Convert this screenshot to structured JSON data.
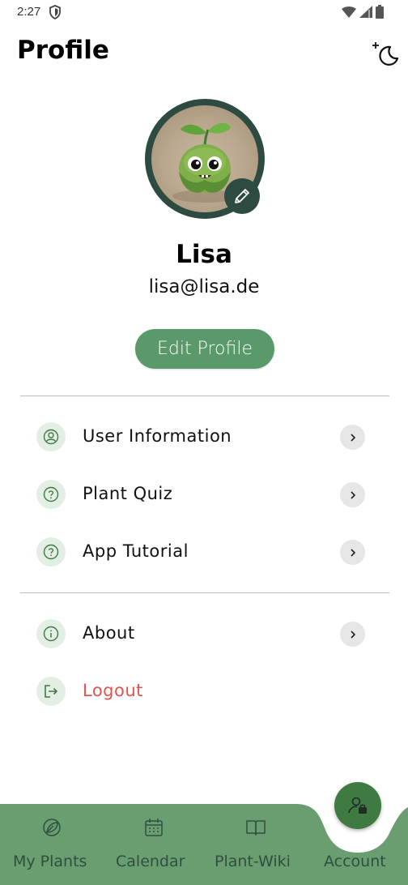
{
  "status_bar": {
    "time": "2:27"
  },
  "header": {
    "title": "Profile",
    "theme_toggle_icon": "moon-sparkle-icon"
  },
  "profile": {
    "name": "Lisa",
    "email": "lisa@lisa.de",
    "edit_button": "Edit Profile",
    "avatar_icon": "plant-character-avatar",
    "edit_avatar_icon": "pencil-icon"
  },
  "menu": {
    "section1": [
      {
        "label": "User Information",
        "icon": "user-circle-icon"
      },
      {
        "label": "Plant Quiz",
        "icon": "question-circle-icon"
      },
      {
        "label": "App Tutorial",
        "icon": "question-circle-icon"
      }
    ],
    "section2": [
      {
        "label": "About",
        "icon": "info-circle-icon"
      },
      {
        "label": "Logout",
        "icon": "logout-icon"
      }
    ]
  },
  "bottom_nav": {
    "items": [
      {
        "label": "My Plants",
        "icon": "plant-leaf-icon"
      },
      {
        "label": "Calendar",
        "icon": "calendar-icon"
      },
      {
        "label": "Plant-Wiki",
        "icon": "book-icon"
      },
      {
        "label": "Account",
        "icon": "account-icon"
      }
    ],
    "active": "Account"
  },
  "colors": {
    "primary_green": "#5a9a6a",
    "nav_green": "#6a9d70",
    "fab_green": "#3f7a43",
    "avatar_ring": "#2d4b40",
    "icon_bg": "#e3efe5",
    "logout_red": "#e0554e"
  }
}
